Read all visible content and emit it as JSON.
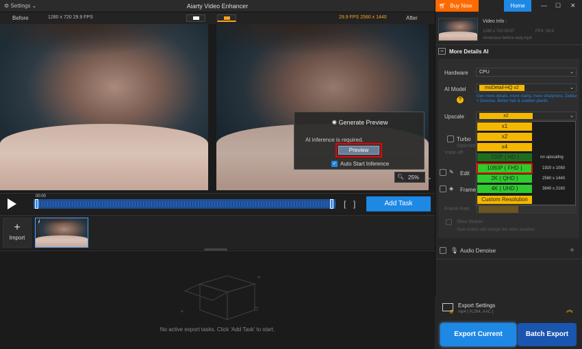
{
  "title_bar": {
    "settings_label": "Settings",
    "app_title": "Aiarty Video Enhancer"
  },
  "compare": {
    "before_label": "Before",
    "before_info": "1280 x 720  29.9 FPS",
    "after_info": "29.9 FPS  2560 x 1440",
    "after_label": "After"
  },
  "preview_popup": {
    "title": "Generate Preview",
    "message": "AI inference is required.",
    "preview_button": "Preview",
    "auto_start_label": "Auto Start Inference"
  },
  "zoom": {
    "value": "25%"
  },
  "timeline": {
    "time_label": "00:00",
    "add_task_label": "Add Task"
  },
  "media_strip": {
    "import_label": "Import",
    "info_icon_label": "i"
  },
  "tasks_area": {
    "empty_message": "No active export tasks. Click 'Add Task' to start."
  },
  "top_right": {
    "buy_now_label": "Buy Now",
    "home_label": "Home"
  },
  "video_info": {
    "heading": "Video Info :",
    "dims_time": "1280 x 720  00:07",
    "fps_label": "FPS: 29.9",
    "file_name": "showcase-before-lady.mp4"
  },
  "more_details": {
    "section_title": "More Details AI",
    "hardware_label": "Hardware",
    "hardware_value": "CPU",
    "ai_model_label": "AI Model",
    "ai_model_value": "moDetail-HQ  v2",
    "ai_model_desc": "Gen more details, more clarity, more sharpness. Deblur + Denoise. Better hair & outdoor plants.",
    "upscale_label": "Upscale",
    "upscale_value": "x2",
    "turbo_label": "Turbo",
    "turbo_desc1": "Optimize",
    "turbo_desc2": "trade-off"
  },
  "upscale_dropdown": {
    "options": [
      {
        "label": "x1",
        "res": ""
      },
      {
        "label": "x2",
        "res": ""
      },
      {
        "label": "x4",
        "res": ""
      },
      {
        "label": "720P ( HD )",
        "res": "no upscaling"
      },
      {
        "label": "1080P ( FHD )",
        "res": "1920 x 1080"
      },
      {
        "label": "2K ( QHD )",
        "res": "2560 x 1440"
      },
      {
        "label": "4K ( UHD )",
        "res": "3840 x 2160"
      },
      {
        "label": "Custom Resolution",
        "res": ""
      }
    ],
    "selected": "1080P ( FHD )"
  },
  "other_settings": {
    "edit_label": "Edit",
    "frame_label": "Frame I",
    "frame_rate_label": "Frame Rate",
    "slow_motion_label": "Slow Motion",
    "slow_motion_desc": "Slow motion will change the video duration",
    "audio_denoise_label": "Audio Denoise"
  },
  "export": {
    "settings_label": "Export Settings",
    "settings_sub": "mp4 [ H.264, AAC ]",
    "export_current_label": "Export Current",
    "batch_export_label": "Batch Export"
  },
  "colors": {
    "accent": "#1e88e5",
    "option_yellow": "#f5b800",
    "option_green": "#2ecc2e",
    "option_dark_green": "#1e7a1e",
    "buy_now": "#ff6a00",
    "highlight_red": "#e00000"
  }
}
